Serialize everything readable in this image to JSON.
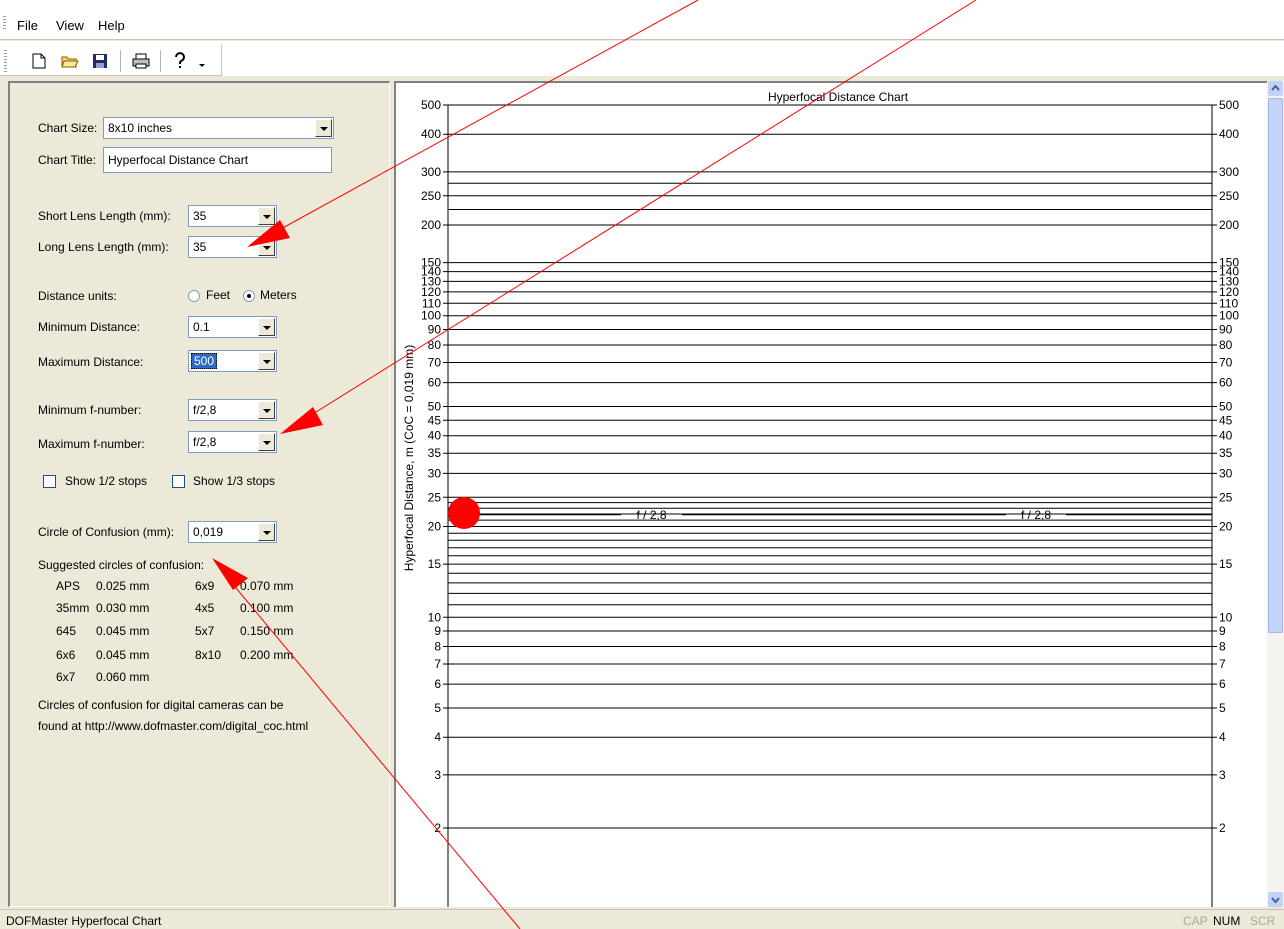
{
  "menu": {
    "file": "File",
    "view": "View",
    "help": "Help"
  },
  "toolbar": {
    "icons": [
      "new-icon",
      "open-icon",
      "save-icon",
      "print-icon",
      "help-icon"
    ]
  },
  "form": {
    "chart_size_label": "Chart Size:",
    "chart_size_value": "8x10 inches",
    "chart_title_label": "Chart Title:",
    "chart_title_value": "Hyperfocal Distance Chart",
    "short_lens_label": "Short Lens Length (mm):",
    "short_lens_value": "35",
    "long_lens_label": "Long Lens Length (mm):",
    "long_lens_value": "35",
    "distance_units_label": "Distance units:",
    "feet_label": "Feet",
    "meters_label": "Meters",
    "distance_units_selected": "Meters",
    "min_distance_label": "Minimum Distance:",
    "min_distance_value": "0.1",
    "max_distance_label": "Maximum Distance:",
    "max_distance_value": "500",
    "min_fnumber_label": "Minimum f-number:",
    "min_fnumber_value": "f/2,8",
    "max_fnumber_label": "Maximum f-number:",
    "max_fnumber_value": "f/2,8",
    "half_stops_label": "Show 1/2 stops",
    "third_stops_label": "Show 1/3 stops",
    "coc_label": "Circle of Confusion (mm):",
    "coc_value": "0,019",
    "suggested_title": "Suggested circles of confusion:",
    "suggested": [
      {
        "format": "APS",
        "value": "0.025 mm",
        "format2": "6x9",
        "value2": "0.070 mm"
      },
      {
        "format": "35mm",
        "value": "0.030 mm",
        "format2": "4x5",
        "value2": "0.100 mm"
      },
      {
        "format": "645",
        "value": "0.045 mm",
        "format2": "5x7",
        "value2": "0.150 mm"
      },
      {
        "format": "6x6",
        "value": "0.045 mm",
        "format2": "8x10",
        "value2": "0.200 mm"
      },
      {
        "format": "6x7",
        "value": "0.060 mm",
        "format2": "",
        "value2": ""
      }
    ],
    "note_line1": "Circles of confusion for digital cameras can be",
    "note_line2": "found at http://www.dofmaster.com/digital_coc.html"
  },
  "chart_data": {
    "type": "line",
    "title": "Hyperfocal Distance Chart",
    "ylabel": "Hyperfocal Distance, m   (CoC = 0,019 mm)",
    "yscale": "log",
    "ylim": [
      1.5,
      500
    ],
    "ticks": [
      2,
      3,
      4,
      5,
      6,
      7,
      8,
      9,
      10,
      15,
      20,
      25,
      30,
      35,
      40,
      45,
      50,
      60,
      70,
      80,
      90,
      100,
      110,
      120,
      130,
      140,
      150,
      200,
      250,
      300,
      400,
      500
    ],
    "tick_labels": [
      "2",
      "3",
      "4",
      "5",
      "6",
      "7",
      "8",
      "9",
      "10",
      "15",
      "20",
      "25",
      "30",
      "35",
      "40",
      "45",
      "50",
      "60",
      "70",
      "80",
      "90",
      "100",
      "110",
      "120",
      "130",
      "140",
      "150",
      "200",
      "250",
      "300",
      "400",
      "500"
    ],
    "minor_lines": [
      11,
      12,
      13,
      14,
      16,
      17,
      18,
      19,
      21,
      22,
      23,
      24,
      225,
      275
    ],
    "series": [
      {
        "name": "f / 2,8",
        "lens_mm": 35,
        "hyperfocal_m": 22.9
      }
    ],
    "series_labels": [
      "f / 2,8",
      "f / 2,8"
    ],
    "grid": true
  },
  "status": {
    "message": "DOFMaster Hyperfocal Chart",
    "cap": "CAP",
    "num": "NUM",
    "scr": "SCR"
  },
  "colors": {
    "annotation": "#ff0000",
    "selection": "#316ac5"
  }
}
